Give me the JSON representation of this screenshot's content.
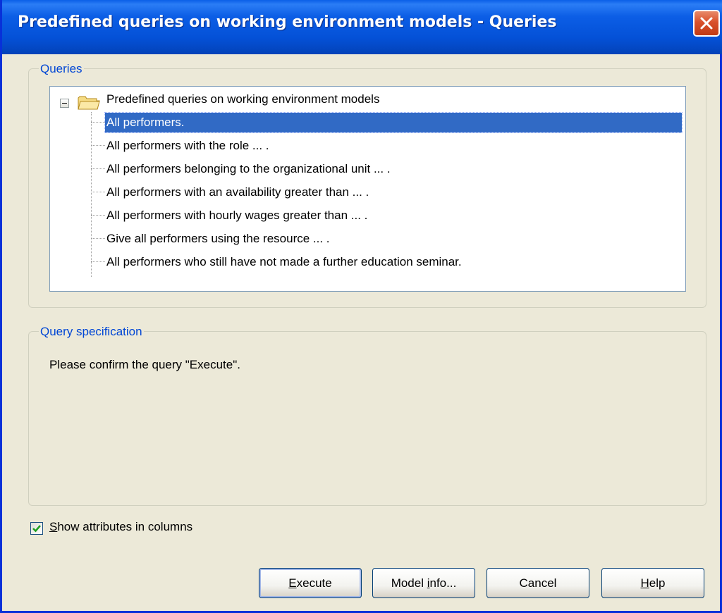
{
  "window": {
    "title": "Predefined queries on working environment models - Queries"
  },
  "queries_group": {
    "label": "Queries",
    "root_label": "Predefined queries on working environment models",
    "items": [
      {
        "label": "All performers.",
        "selected": true
      },
      {
        "label": "All performers with the role ... .",
        "selected": false
      },
      {
        "label": "All performers belonging to the organizational unit ... .",
        "selected": false
      },
      {
        "label": "All performers with an availability greater than ... .",
        "selected": false
      },
      {
        "label": "All performers with hourly wages greater than ... .",
        "selected": false
      },
      {
        "label": "Give all performers using the resource ... .",
        "selected": false
      },
      {
        "label": "All performers who still have not made a further education seminar.",
        "selected": false
      }
    ]
  },
  "spec_group": {
    "label": "Query specification",
    "text": "Please confirm the query \"Execute\"."
  },
  "options": {
    "show_attributes_label_rest": "how attributes in columns",
    "show_attributes_mnemonic": "S",
    "show_attributes_checked": true
  },
  "buttons": {
    "execute": {
      "mnemonic": "E",
      "rest": "xecute"
    },
    "model_info": {
      "prefix": "Model ",
      "mnemonic": "i",
      "rest": "nfo..."
    },
    "cancel": "Cancel",
    "help": {
      "mnemonic": "H",
      "rest": "elp"
    }
  },
  "colors": {
    "titlebar": "#0451d7",
    "selection": "#316ac5",
    "group_label": "#0046d5",
    "dialog_bg": "#ece9d8"
  },
  "icons": {
    "close": "close-icon",
    "folder": "folder-icon",
    "check": "check-icon"
  }
}
